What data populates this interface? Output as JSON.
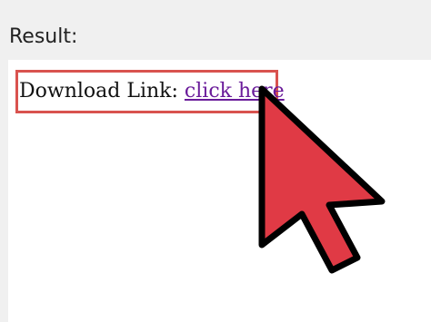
{
  "heading": "Result:",
  "link_prefix": "Download Link: ",
  "link_text": "click here",
  "colors": {
    "highlight": "#d9534f",
    "cursor_fill": "#e03a45",
    "cursor_outline": "#000000",
    "link": "#6a1b9a"
  },
  "icons": {
    "pointer": "mouse-pointer-arrow-icon"
  }
}
